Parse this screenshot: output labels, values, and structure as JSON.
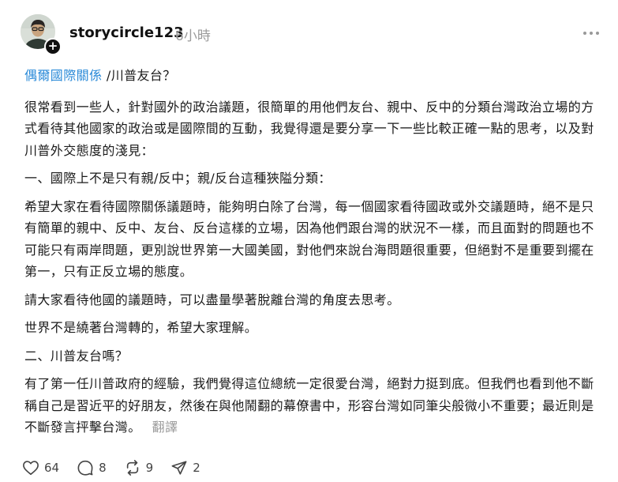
{
  "post": {
    "username": "storycircle123",
    "time": "6小時",
    "tag": "偶爾國際關係",
    "title": "/川普友台？",
    "paragraphs": [
      "很常看到一些人，針對國外的政治議題，很簡單的用他們友台、親中、反中的分類台灣政治立場的方式看待其他國家的政治或是國際間的互動，我覺得還是要分享一下一些比較正確一點的思考，以及對川普外交態度的淺見：",
      "一、國際上不是只有親/反中；親/反台這種狹隘分類：",
      "希望大家在看待國際關係議題時，能夠明白除了台灣，每一個國家看待國政或外交議題時，絕不是只有簡單的親中、反中、友台、反台這樣的立場，因為他們跟台灣的狀況不一樣，而且面對的問題也不可能只有兩岸問題，更別說世界第一大國美國，對他們來說台海問題很重要，但絕對不是重要到擺在第一，只有正反立場的態度。",
      "請大家看待他國的議題時，可以盡量學著脫離台灣的角度去思考。",
      "世界不是繞著台灣轉的，希望大家理解。",
      "二、川普友台嗎？"
    ],
    "last_paragraph": "有了第一任川普政府的經驗，我們覺得這位總統一定很愛台灣，絕對力挺到底。但我們也看到他不斷稱自己是習近平的好朋友，然後在與他鬧翻的幕僚書中，形容台灣如同筆尖般微小不重要；最近則是不斷發言抨擊台灣。",
    "translate_label": "翻譯"
  },
  "actions": {
    "likes": "64",
    "comments": "8",
    "reposts": "9",
    "shares": "2"
  },
  "colors": {
    "tag": "#2a8ad8",
    "muted": "#9a9a9a",
    "text": "#1a1a1a"
  }
}
